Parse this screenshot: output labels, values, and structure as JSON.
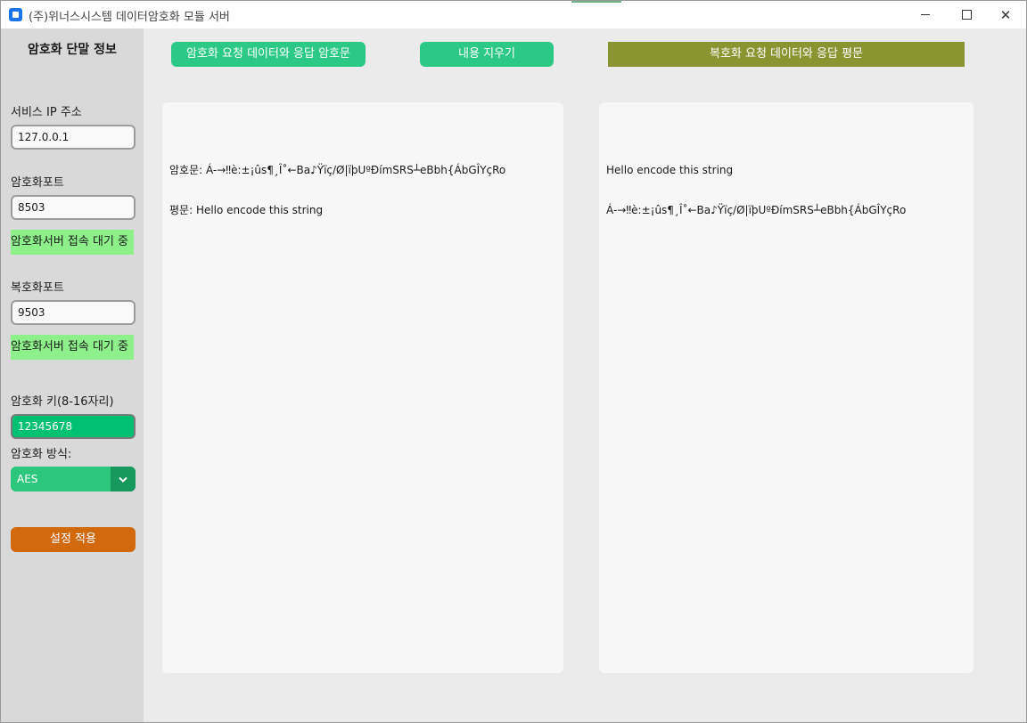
{
  "window": {
    "title": "(주)위너스시스템 데이터암호화 모듈 서버",
    "controls": {
      "minimize": "—",
      "maximize": "☐",
      "close": "✕"
    }
  },
  "sidebar": {
    "title": "암호화 단말 정보",
    "service_ip": {
      "label": "서비스 IP 주소",
      "value": "127.0.0.1"
    },
    "encrypt_port": {
      "label": "암호화포트",
      "value": "8503",
      "status": "암호화서버 접속 대기 중"
    },
    "decrypt_port": {
      "label": "복호화포트",
      "value": "9503",
      "status": "암호화서버 접속 대기 중"
    },
    "key": {
      "label": "암호화 키(8-16자리)",
      "value": "12345678"
    },
    "method": {
      "label": "암호화 방식:",
      "value": "AES"
    },
    "apply_button": "설정 적용"
  },
  "toolbar": {
    "encrypt_button": "암호화 요청 데이터와 응답 암호문",
    "clear_button": "내용 지우기",
    "decrypt_button": "복호화 요청 데이터와 응답 평문"
  },
  "panels": {
    "left": {
      "lines": [
        "암호문: Á-→‼è:±¡ûs¶¸Î˚←Ba♪Ÿïç/Ø|ïþUºÐímSRS┴eBbh{ÁbGÎYçRo",
        "평문: Hello encode this string"
      ]
    },
    "right": {
      "lines": [
        "Hello encode this string",
        "Á-→‼è:±¡ûs¶¸Î˚←Ba♪Ÿïç/Ø|ïþUºÐímSRS┴eBbh{ÁbGÎYçRo"
      ]
    }
  },
  "colors": {
    "sidebar_bg": "#d9d9d9",
    "status_green": "#8ef08a",
    "button_green": "#2cc986",
    "button_olive": "#8a9431",
    "button_orange": "#d2690e",
    "key_field": "#00c072"
  }
}
